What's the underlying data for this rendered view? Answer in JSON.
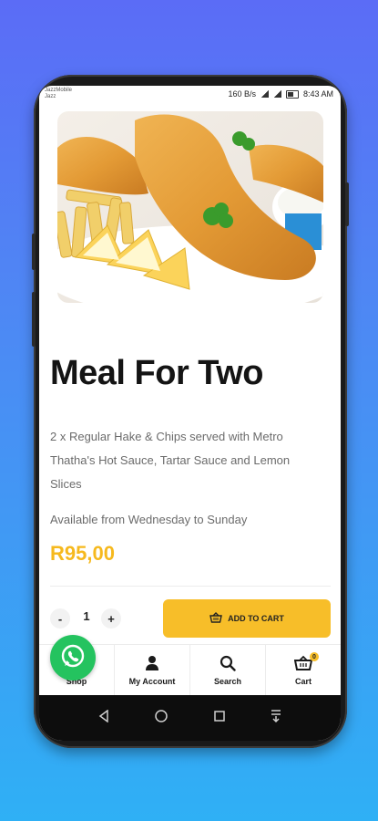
{
  "status_bar": {
    "carrier_line1": "JazzMobile",
    "carrier_line2": "Jazz",
    "net_speed": "160 B/s",
    "time": "8:43 AM"
  },
  "product": {
    "title": "Meal For Two",
    "description": "2 x Regular Hake & Chips served with Metro Thatha's Hot Sauce, Tartar Sauce and Lemon Slices",
    "availability": "Available from Wednesday to Sunday",
    "price": "R95,00",
    "image_icon": "fish-and-chips-image"
  },
  "quantity": {
    "minus_label": "-",
    "value": "1",
    "plus_label": "+"
  },
  "cart_button": {
    "label": "ADD TO CART",
    "icon": "basket-icon"
  },
  "bottom_nav": {
    "items": [
      {
        "label": "Shop",
        "icon": "shop-icon"
      },
      {
        "label": "My Account",
        "icon": "user-icon"
      },
      {
        "label": "Search",
        "icon": "search-icon"
      },
      {
        "label": "Cart",
        "icon": "cart-icon"
      }
    ],
    "cart_count": "0"
  },
  "colors": {
    "accent": "#f7be29",
    "price": "#f6b91e",
    "whatsapp": "#24c35f",
    "background_top": "#5b6cf6",
    "background_bottom": "#2fb0f5"
  }
}
